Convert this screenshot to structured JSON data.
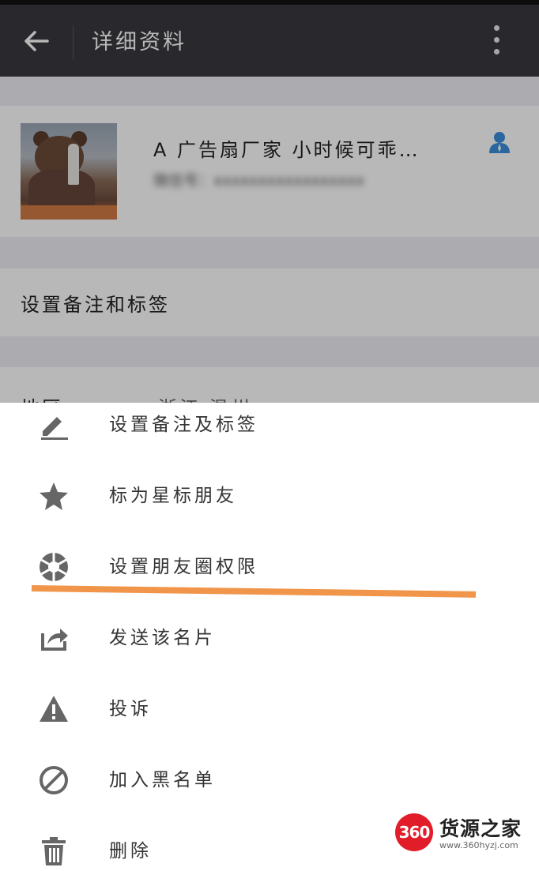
{
  "header": {
    "title": "详细资料"
  },
  "profile": {
    "nickname": "A 广告扇厂家  小时候可乖…",
    "wechat_id": "微信号：xxxxxxxxxxxxxxxxx"
  },
  "remark_row": {
    "label": "设置备注和标签"
  },
  "region_row": {
    "label": "地区",
    "value": "浙江  温州"
  },
  "menu": {
    "items": [
      {
        "label": "设置备注及标签",
        "icon": "pencil-icon"
      },
      {
        "label": "标为星标朋友",
        "icon": "star-icon"
      },
      {
        "label": "设置朋友圈权限",
        "icon": "aperture-icon"
      },
      {
        "label": "发送该名片",
        "icon": "share-icon"
      },
      {
        "label": "投诉",
        "icon": "warning-icon"
      },
      {
        "label": "加入黑名单",
        "icon": "block-icon"
      },
      {
        "label": "删除",
        "icon": "trash-icon"
      }
    ]
  },
  "watermark": {
    "badge": "360",
    "title": "货源之家",
    "url": "www.360hyzj.com"
  },
  "colors": {
    "top_bar": "#393a3f",
    "highlight": "#f0954a",
    "contact_icon": "#3b8fdb",
    "icon_gray": "#666666",
    "watermark_red": "#e11d2a"
  }
}
